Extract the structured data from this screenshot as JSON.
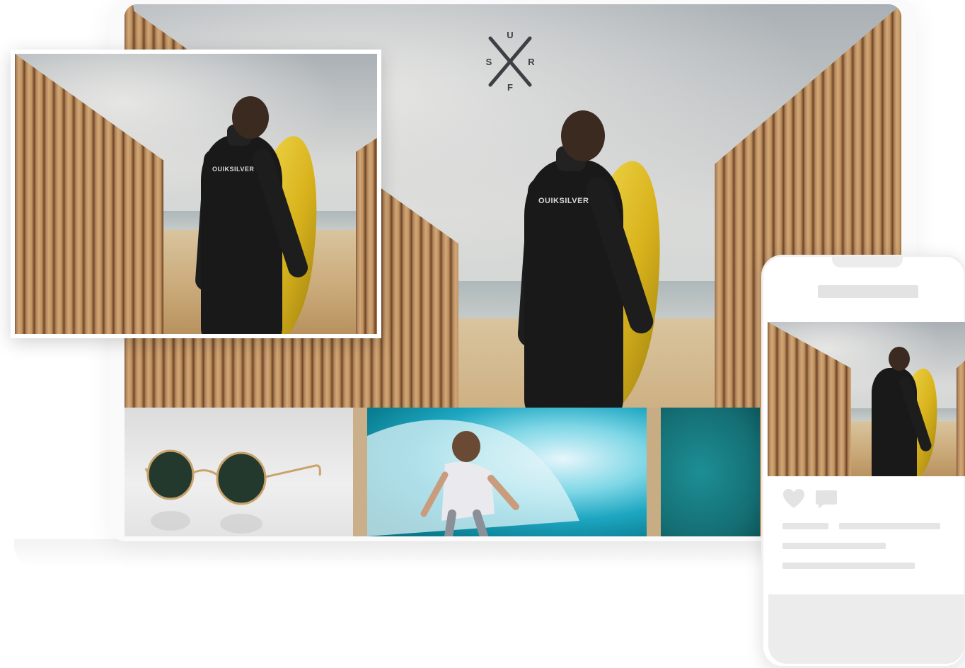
{
  "logo": {
    "letters": {
      "top": "U",
      "left": "S",
      "right": "R",
      "bottom": "F"
    }
  },
  "hero": {
    "wetsuit_text": "OUIKSILVER"
  },
  "phone": {
    "like_icon": "heart-icon",
    "comment_icon": "comment-icon"
  },
  "colors": {
    "board": "#e4c52c",
    "wetsuit": "#1a1a1a",
    "wave": "#1ea7c2",
    "teal_tile": "#146f74",
    "placeholder": "#e5e5e5"
  }
}
